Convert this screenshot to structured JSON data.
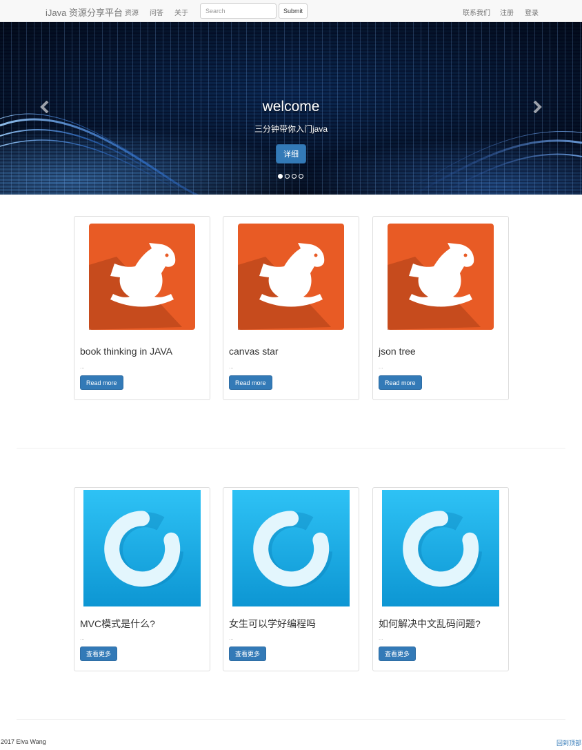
{
  "navbar": {
    "brand": "iJava 资源分享平台",
    "links": [
      "资源",
      "问答",
      "关于"
    ],
    "search_placeholder": "Search",
    "submit_label": "Submit",
    "right_links": [
      "联系我们",
      "注册",
      "登录"
    ]
  },
  "carousel": {
    "title": "welcome",
    "subtitle": "三分钟带你入门java",
    "button_label": "详细",
    "slide_count": 4,
    "active_slide": 1,
    "prev_icon": "chevron-left-icon",
    "next_icon": "chevron-right-icon"
  },
  "resources": [
    {
      "title": "book thinking in JAVA",
      "excerpt": "...",
      "button": "Read more"
    },
    {
      "title": "canvas star",
      "excerpt": "...",
      "button": "Read more"
    },
    {
      "title": "json tree",
      "excerpt": "...",
      "button": "Read more"
    }
  ],
  "questions": [
    {
      "title": "MVC模式是什么?",
      "excerpt": "...",
      "button": "查看更多"
    },
    {
      "title": "女生可以学好编程吗",
      "excerpt": "...",
      "button": "查看更多"
    },
    {
      "title": "如何解决中文乱码问题?",
      "excerpt": "...",
      "button": "查看更多"
    }
  ],
  "footer": {
    "copyright": "2017 Elva Wang",
    "back_to_top": "回到顶部"
  },
  "colors": {
    "primary": "#337ab7",
    "resource_icon_bg": "#e85b25",
    "question_icon_bg": "#1aa7de"
  },
  "icons": {
    "resource": "rocking-horse-icon",
    "question": "loading-ring-icon"
  }
}
